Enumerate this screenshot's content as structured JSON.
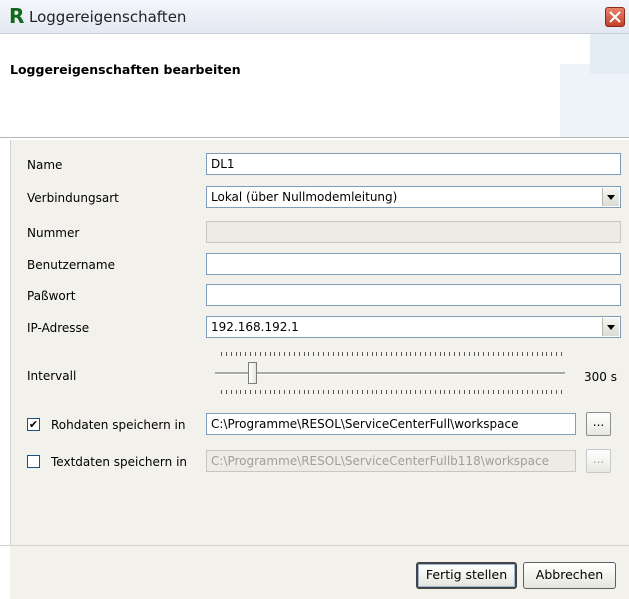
{
  "window": {
    "logo_letter": "R",
    "title": "Loggereigenschaften"
  },
  "header": {
    "title": "Loggereigenschaften bearbeiten"
  },
  "form": {
    "name_label": "Name",
    "name_value": "DL1",
    "connection_label": "Verbindungsart",
    "connection_value": "Lokal (über Nullmodemleitung)",
    "number_label": "Nummer",
    "number_value": "",
    "username_label": "Benutzername",
    "username_value": "",
    "password_label": "Paßwort",
    "password_value": "",
    "ip_label": "IP-Adresse",
    "ip_value": "192.168.192.1",
    "interval_label": "Intervall",
    "interval_value": "300 s",
    "interval_slider_fraction": 0.08,
    "raw_checked": true,
    "raw_label": "Rohdaten speichern in",
    "raw_path": "C:\\Programme\\RESOL\\ServiceCenterFull\\workspace",
    "text_checked": false,
    "text_label": "Textdaten speichern in",
    "text_path": "C:\\Programme\\RESOL\\ServiceCenterFullb118\\workspace",
    "browse_label": "..."
  },
  "buttons": {
    "finish": "Fertig stellen",
    "cancel": "Abbrechen"
  },
  "icons": {
    "close": "close-icon",
    "dropdown": "chevron-down-icon",
    "check": "check-icon"
  },
  "colors": {
    "logo": "#0f6a1d",
    "close": "#c4402a",
    "field_border": "#7f9db9"
  }
}
